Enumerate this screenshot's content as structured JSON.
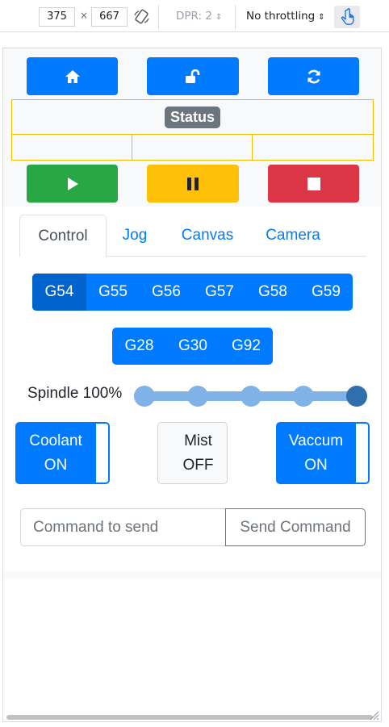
{
  "devtools": {
    "width_value": "375",
    "height_value": "667",
    "times": "×",
    "dpr_label": "DPR: 2",
    "throttle_label": "No throttling",
    "icons": [
      "rotate-icon",
      "touch-hand-icon",
      "select-arrows-icon"
    ]
  },
  "controls": {
    "icons": [
      "home-icon",
      "unlock-icon",
      "refresh-icon",
      "play-icon",
      "pause-icon",
      "stop-icon"
    ]
  },
  "status": {
    "label": "Status"
  },
  "tabs": [
    "Control",
    "Jog",
    "Canvas",
    "Camera"
  ],
  "wcs": {
    "buttons": [
      "G54",
      "G55",
      "G56",
      "G57",
      "G58",
      "G59"
    ],
    "active": "G54"
  },
  "goto": {
    "buttons": [
      "G28",
      "G30",
      "G92"
    ]
  },
  "spindle": {
    "label": "Spindle 100%",
    "level_fraction": 1.0,
    "steps": 5
  },
  "toggles": {
    "coolant": {
      "line1": "Coolant",
      "line2": "ON"
    },
    "mist": {
      "line1": "Mist",
      "line2": "OFF"
    },
    "vaccum": {
      "line1": "Vaccum",
      "line2": "ON"
    }
  },
  "command": {
    "placeholder": "Command to send",
    "send_label": "Send Command"
  },
  "colors": {
    "primary": "#007bff",
    "success": "#28a745",
    "warning": "#ffc107",
    "danger": "#dc3545",
    "status_border": "#f0c000"
  }
}
